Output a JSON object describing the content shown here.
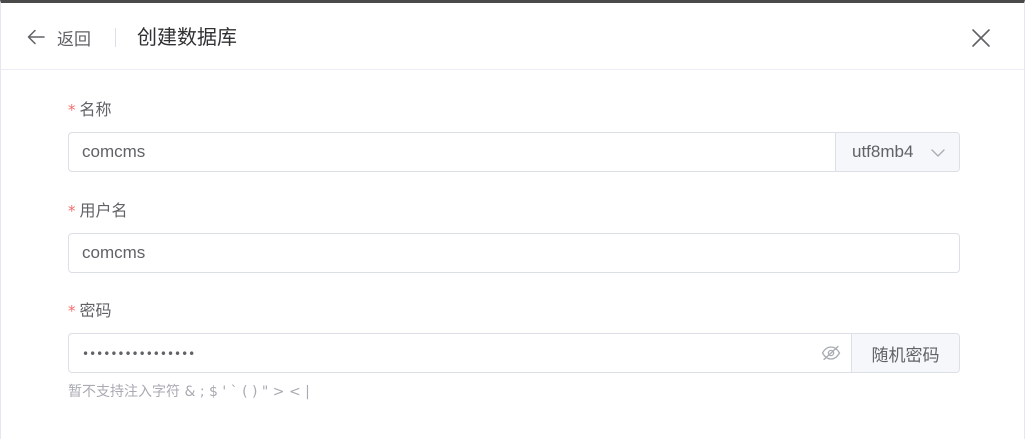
{
  "header": {
    "back_label": "返回",
    "title": "创建数据库",
    "icons": {
      "back": "arrow-left-icon",
      "close": "close-icon"
    }
  },
  "form": {
    "name": {
      "required_mark": "*",
      "label": "名称",
      "value": "comcms",
      "charset": "utf8mb4",
      "charset_icon": "chevron-down-icon"
    },
    "username": {
      "required_mark": "*",
      "label": "用户名",
      "value": "comcms"
    },
    "password": {
      "required_mark": "*",
      "label": "密码",
      "masked_value": "••••••••••••••••",
      "visibility_icon": "eye-hidden-icon",
      "random_button": "随机密码",
      "hint": "暂不支持注入字符 & ; $ ' ` ( ) \" > < |"
    }
  },
  "colors": {
    "required": "#f56c6c",
    "border": "#dcdfe6",
    "append_bg": "#f5f7fa",
    "text": "#606266",
    "hint": "#a8abb2"
  }
}
